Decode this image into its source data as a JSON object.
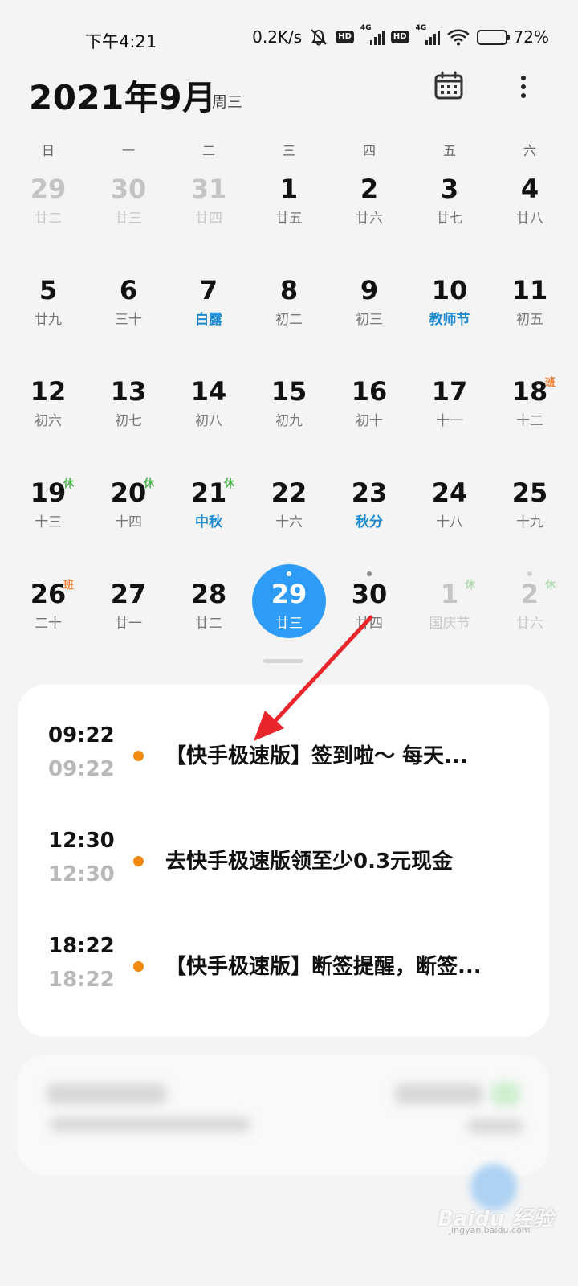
{
  "status_bar": {
    "time": "下午4:21",
    "net_speed": "0.2K/s",
    "hd_label": "HD",
    "net_type": "4G",
    "battery": "72%",
    "battery_level": 0.72
  },
  "header": {
    "title": "2021年9月",
    "weekday": "周三"
  },
  "weekdays": [
    "日",
    "一",
    "二",
    "三",
    "四",
    "五",
    "六"
  ],
  "days": [
    {
      "d": "29",
      "l": "廿二",
      "faded": true
    },
    {
      "d": "30",
      "l": "廿三",
      "faded": true
    },
    {
      "d": "31",
      "l": "廿四",
      "faded": true
    },
    {
      "d": "1",
      "l": "廿五"
    },
    {
      "d": "2",
      "l": "廿六"
    },
    {
      "d": "3",
      "l": "廿七"
    },
    {
      "d": "4",
      "l": "廿八"
    },
    {
      "d": "5",
      "l": "廿九"
    },
    {
      "d": "6",
      "l": "三十"
    },
    {
      "d": "7",
      "l": "白露",
      "fest": true
    },
    {
      "d": "8",
      "l": "初二"
    },
    {
      "d": "9",
      "l": "初三"
    },
    {
      "d": "10",
      "l": "教师节",
      "fest": true
    },
    {
      "d": "11",
      "l": "初五"
    },
    {
      "d": "12",
      "l": "初六"
    },
    {
      "d": "13",
      "l": "初七"
    },
    {
      "d": "14",
      "l": "初八"
    },
    {
      "d": "15",
      "l": "初九"
    },
    {
      "d": "16",
      "l": "初十"
    },
    {
      "d": "17",
      "l": "十一"
    },
    {
      "d": "18",
      "l": "十二",
      "badge": "班",
      "badge_type": "work"
    },
    {
      "d": "19",
      "l": "十三",
      "badge": "休",
      "badge_type": "rest"
    },
    {
      "d": "20",
      "l": "十四",
      "badge": "休",
      "badge_type": "rest"
    },
    {
      "d": "21",
      "l": "中秋",
      "fest": true,
      "badge": "休",
      "badge_type": "rest"
    },
    {
      "d": "22",
      "l": "十六"
    },
    {
      "d": "23",
      "l": "秋分",
      "fest": true
    },
    {
      "d": "24",
      "l": "十八"
    },
    {
      "d": "25",
      "l": "十九"
    },
    {
      "d": "26",
      "l": "二十",
      "badge": "班",
      "badge_type": "work"
    },
    {
      "d": "27",
      "l": "廿一"
    },
    {
      "d": "28",
      "l": "廿二"
    },
    {
      "d": "29",
      "l": "廿三",
      "today": true,
      "dot": true
    },
    {
      "d": "30",
      "l": "廿四",
      "dot": true
    },
    {
      "d": "1",
      "l": "国庆节",
      "faded": true,
      "badge": "休",
      "badge_type": "rest"
    },
    {
      "d": "2",
      "l": "廿六",
      "faded": true,
      "dot": true,
      "badge": "休",
      "badge_type": "rest"
    }
  ],
  "events": [
    {
      "start": "09:22",
      "end": "09:22",
      "title": "【快手极速版】签到啦～ 每天..."
    },
    {
      "start": "12:30",
      "end": "12:30",
      "title": "去快手极速版领至少0.3元现金"
    },
    {
      "start": "18:22",
      "end": "18:22",
      "title": "【快手极速版】断签提醒，断签..."
    }
  ],
  "watermark": {
    "brand": "Baidu 经验",
    "url": "jingyan.baidu.com"
  },
  "colors": {
    "today": "#2e9cf6",
    "festival": "#1b8ad0",
    "rest_badge": "#4cb04c",
    "work_badge": "#f07b2c",
    "event_dot": "#f28a12",
    "annotation_arrow": "#e8262b"
  }
}
